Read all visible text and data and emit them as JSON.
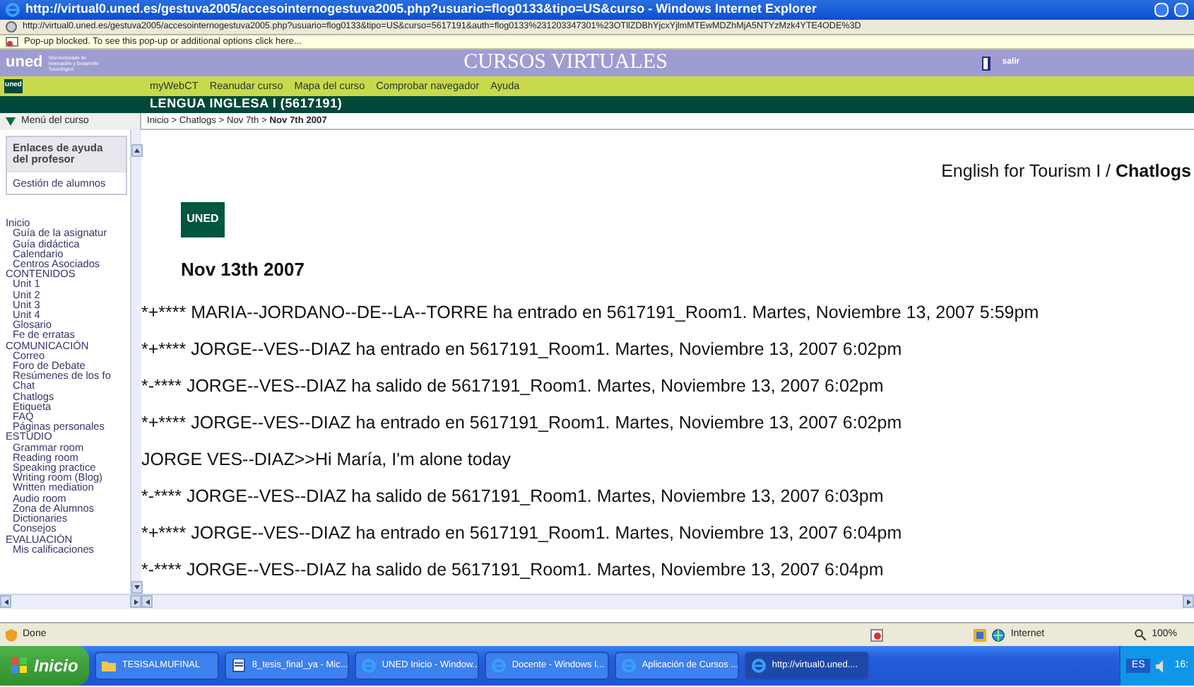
{
  "window": {
    "title": "http://virtual0.uned.es/gestuva2005/accesointernogestuva2005.php?usuario=flog0133&tipo=US&curso - Windows Internet Explorer"
  },
  "address": "http://virtual0.uned.es/gestuva2005/accesointernogestuva2005.php?usuario=flog0133&tipo=US&curso=5617191&auth=flog0133%231203347301%23OTllZDBhYjcxYjlmMTEwMDZhMjA5NTYzMzk4YTE4ODE%3D",
  "popup_bar": "Pop-up blocked. To see this pop-up or additional options click here...",
  "header": {
    "logo": "uned",
    "logo_caption": "Vicerrectorado de Innovación y Desarrollo Tecnológico",
    "title": "CURSOS VIRTUALES",
    "exit": "salir"
  },
  "nav": {
    "logo": "uned",
    "links": [
      "myWebCT",
      "Reanudar curso",
      "Mapa del curso",
      "Comprobar navegador",
      "Ayuda"
    ]
  },
  "course_title": "LENGUA INGLESA I  (5617191)",
  "sidebar": {
    "toggle": "Menú del curso",
    "expanded": true,
    "help_heading": "Enlaces de ayuda del profesor",
    "help_links": [
      "Gestión de alumnos"
    ],
    "menu": [
      {
        "label": "Inicio",
        "children": [
          {
            "label": "Guía de la asignatur"
          },
          {
            "label": "Guía didáctica"
          },
          {
            "label": "Calendario"
          },
          {
            "label": "Centros Asociados"
          }
        ]
      },
      {
        "label": "CONTENIDOS",
        "children": [
          {
            "label": "Unit 1"
          },
          {
            "label": "Unit 2"
          },
          {
            "label": "Unit 3"
          },
          {
            "label": "Unit 4"
          },
          {
            "label": "Glosario"
          },
          {
            "label": "Fe de erratas"
          }
        ]
      },
      {
        "label": "COMUNICACIÓN",
        "children": [
          {
            "label": "Correo"
          },
          {
            "label": "Foro de Debate"
          },
          {
            "label": "Resúmenes de los fo"
          },
          {
            "label": "Chat"
          },
          {
            "label": "Chatlogs"
          },
          {
            "label": "Etiqueta"
          },
          {
            "label": "FAQ"
          },
          {
            "label": "Páginas personales"
          }
        ]
      },
      {
        "label": "ESTUDIO",
        "children": [
          {
            "label": "Grammar room"
          },
          {
            "label": "Reading room"
          },
          {
            "label": "Speaking practice"
          },
          {
            "label": "Writing room (Blog)"
          },
          {
            "label": "Written mediation"
          },
          {
            "label": "Audio room"
          },
          {
            "label": "Zona de Alumnos"
          },
          {
            "label": "Dictionaries"
          },
          {
            "label": "Consejos"
          }
        ]
      },
      {
        "label": "EVALUACIÓN",
        "children": [
          {
            "label": "Mis calificaciones"
          }
        ]
      }
    ]
  },
  "breadcrumb": "Inicio > Chatlogs > Nov 7th > **Nov 7th 2007**",
  "page": {
    "heading": "English for Tourism I / **Chatlogs**",
    "logo": "UNED",
    "date": "Nov 13th 2007",
    "messages": [
      "*+**** MARIA--JORDANO--DE--LA--TORRE ha entrado en 5617191_Room1. Martes, Noviembre 13, 2007 5:59pm",
      "*+**** JORGE--VES--DIAZ ha entrado en 5617191_Room1. Martes, Noviembre 13, 2007 6:02pm",
      "*-**** JORGE--VES--DIAZ ha salido de 5617191_Room1. Martes, Noviembre 13, 2007 6:02pm",
      "*+**** JORGE--VES--DIAZ ha entrado en 5617191_Room1. Martes, Noviembre 13, 2007 6:02pm",
      "JORGE  VES--DIAZ>>Hi María, I'm alone today",
      "*-**** JORGE--VES--DIAZ ha salido de 5617191_Room1. Martes, Noviembre 13, 2007 6:03pm",
      "*+**** JORGE--VES--DIAZ ha entrado en 5617191_Room1. Martes, Noviembre 13, 2007 6:04pm",
      "*-**** JORGE--VES--DIAZ ha salido de 5617191_Room1. Martes, Noviembre 13, 2007 6:04pm"
    ]
  },
  "status_bar": {
    "text": "Done",
    "zone": "Internet",
    "zoom": "100%"
  },
  "taskbar": {
    "start": "Inicio",
    "items": [
      {
        "label": "TESISALMUFINAL",
        "kind": "folder",
        "selected": false
      },
      {
        "label": "8_tesis_final_ya - Mic...",
        "kind": "document",
        "selected": false
      },
      {
        "label": "UNED Inicio - Window...",
        "kind": "browser",
        "selected": false
      },
      {
        "label": "Docente - Windows I...",
        "kind": "browser",
        "selected": false
      },
      {
        "label": "Aplicación de Cursos ...",
        "kind": "browser",
        "selected": false
      },
      {
        "label": "http://virtual0.uned....",
        "kind": "browser",
        "selected": true
      }
    ],
    "language": "ES",
    "clock": "16:"
  }
}
